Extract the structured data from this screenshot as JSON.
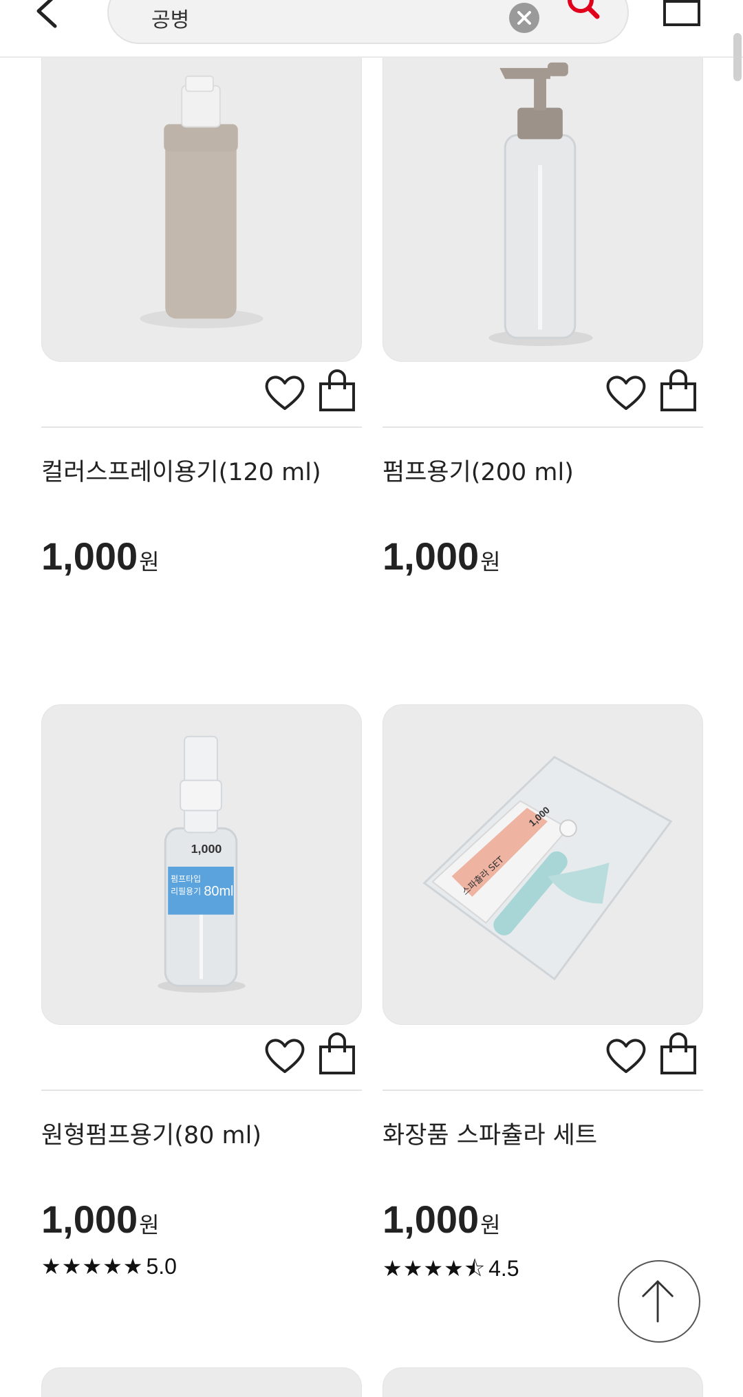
{
  "header": {
    "search_query": "공병",
    "back_icon": "chevron-left-icon",
    "clear_icon": "close-circle-icon",
    "search_icon": "search-icon",
    "cart_icon": "shopping-bag-icon",
    "accent_color": "#e0001b"
  },
  "products": [
    {
      "name": "컬러스프레이용기(120 ml)",
      "price": "1,000",
      "unit": "원",
      "image": "beige spray bottle"
    },
    {
      "name": "펌프용기(200 ml)",
      "price": "1,000",
      "unit": "원",
      "image": "clear pump bottle"
    },
    {
      "name": "원형펌프용기(80 ml)",
      "price": "1,000",
      "unit": "원",
      "image": "round clear spray bottle 80ml",
      "stars": "★★★★★",
      "rating": "5.0"
    },
    {
      "name": "화장품 스파츌라 세트",
      "price": "1,000",
      "unit": "원",
      "image": "cosmetic spatula set in pouch",
      "stars": "★★★★⯪",
      "rating": "4.5"
    }
  ],
  "product_label_text": {
    "bottle_brand": "1,000",
    "bottle_label_1": "펌프타입",
    "bottle_label_2": "리필용기",
    "bottle_label_3": "80ml",
    "spatula_label": "스파츌라 SET"
  },
  "scroll_top_icon": "arrow-up-icon"
}
